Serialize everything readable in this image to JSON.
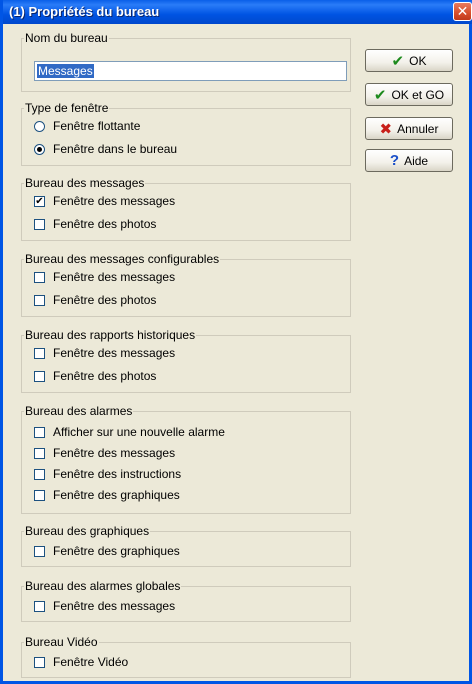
{
  "window": {
    "title": "(1) Propriétés du bureau",
    "close_glyph": "✕"
  },
  "buttons": {
    "ok": {
      "label": "OK",
      "icon": "check-icon",
      "glyph": "✔"
    },
    "ok_go": {
      "label": "OK et GO",
      "icon": "check-icon",
      "glyph": "✔"
    },
    "cancel": {
      "label": "Annuler",
      "icon": "x-icon",
      "glyph": "✖"
    },
    "help": {
      "label": "Aide",
      "icon": "question-icon",
      "glyph": "?"
    }
  },
  "name_group": {
    "legend": "Nom du bureau",
    "value": "Messages"
  },
  "window_type": {
    "legend": "Type de fenêtre",
    "options": [
      {
        "label": "Fenêtre flottante",
        "selected": false
      },
      {
        "label": "Fenêtre dans le bureau",
        "selected": true
      }
    ]
  },
  "groups": [
    {
      "legend": "Bureau des messages",
      "items": [
        {
          "label": "Fenêtre des messages",
          "checked": true
        },
        {
          "label": "Fenêtre des photos",
          "checked": false
        }
      ]
    },
    {
      "legend": "Bureau des messages configurables",
      "items": [
        {
          "label": "Fenêtre des messages",
          "checked": false
        },
        {
          "label": "Fenêtre des photos",
          "checked": false
        }
      ]
    },
    {
      "legend": "Bureau des rapports historiques",
      "items": [
        {
          "label": "Fenêtre des messages",
          "checked": false
        },
        {
          "label": "Fenêtre des photos",
          "checked": false
        }
      ]
    },
    {
      "legend": "Bureau des alarmes",
      "items": [
        {
          "label": "Afficher sur une nouvelle alarme",
          "checked": false
        },
        {
          "label": "Fenêtre des messages",
          "checked": false
        },
        {
          "label": "Fenêtre des instructions",
          "checked": false
        },
        {
          "label": "Fenêtre des graphiques",
          "checked": false
        }
      ]
    },
    {
      "legend": "Bureau des graphiques",
      "items": [
        {
          "label": "Fenêtre des graphiques",
          "checked": false
        }
      ]
    },
    {
      "legend": "Bureau des alarmes globales",
      "items": [
        {
          "label": "Fenêtre des messages",
          "checked": false
        }
      ]
    },
    {
      "legend": "Bureau Vidéo",
      "items": [
        {
          "label": "Fenêtre Vidéo",
          "checked": false
        }
      ]
    }
  ],
  "colors": {
    "titlebar": "#0054e3",
    "accent_selection": "#316ac5",
    "close_button": "#d64e2c",
    "dialog_bg": "#ece9d8"
  }
}
